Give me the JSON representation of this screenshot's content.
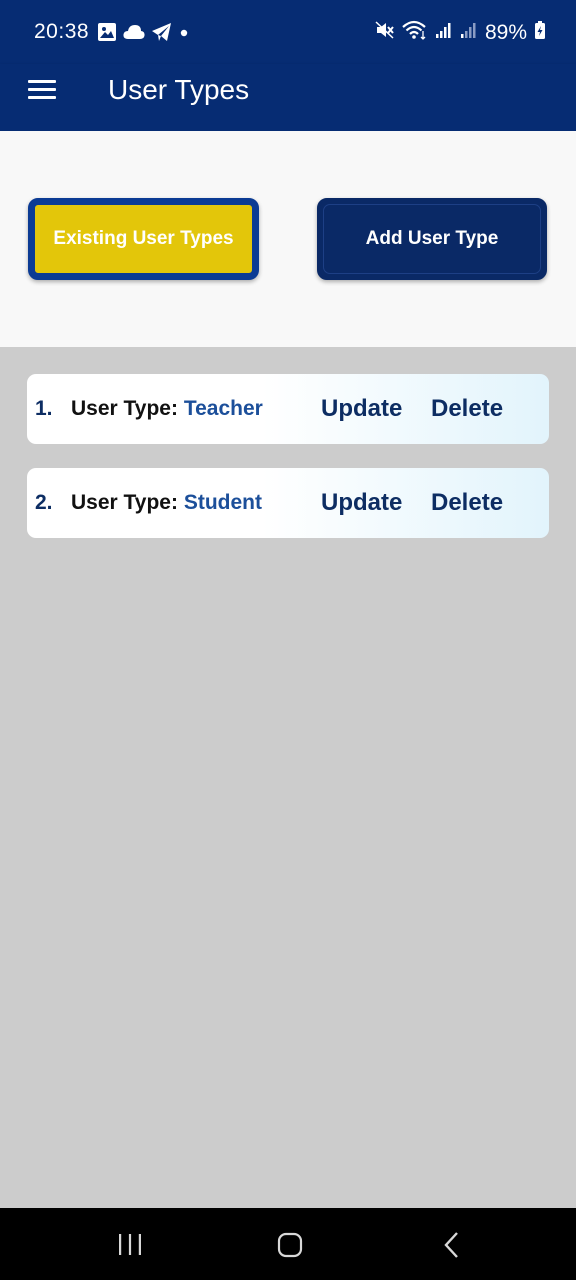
{
  "status_bar": {
    "time": "20:38",
    "battery": "89%",
    "left_icons": [
      "image-icon",
      "cloud-icon",
      "telegram-icon",
      "dot-icon"
    ],
    "right_icons": [
      "mute-icon",
      "wifi-icon",
      "signal-icon",
      "signal-icon-2",
      "battery-icon"
    ]
  },
  "app_bar": {
    "title": "User Types",
    "menu_icon": "hamburger-menu-icon"
  },
  "tabs": {
    "existing_label": "Existing User Types",
    "add_label": "Add User Type",
    "active": "existing"
  },
  "user_types": [
    {
      "number": "1.",
      "label": "User Type:",
      "value": "Teacher",
      "update": "Update",
      "delete": "Delete"
    },
    {
      "number": "2.",
      "label": "User Type:",
      "value": "Student",
      "update": "Update",
      "delete": "Delete"
    }
  ],
  "nav_bar": {
    "icons": [
      "recent-apps-icon",
      "home-icon",
      "back-icon"
    ]
  },
  "colors": {
    "primary": "#062c73",
    "accent": "#e3c60a",
    "background": "#cccccc",
    "text_blue": "#0d2d63"
  }
}
